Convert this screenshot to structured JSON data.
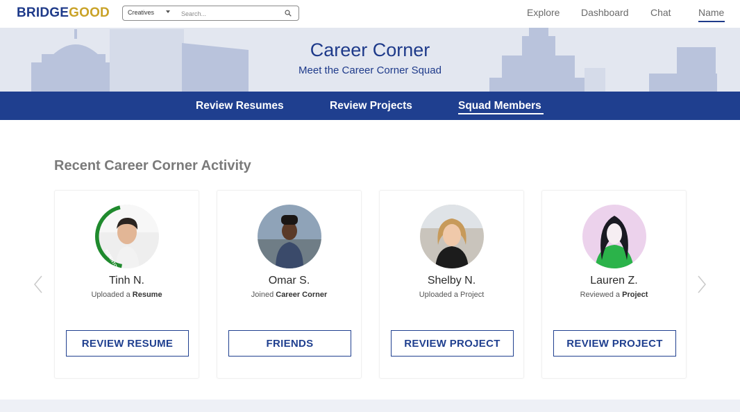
{
  "brand": {
    "part1": "BRIDGE",
    "part2": "GOOD",
    "color_primary": "#1e3a8a",
    "color_accent": "#c9a227"
  },
  "search": {
    "category": "Creatives",
    "placeholder": "Search...",
    "icon": "search-icon"
  },
  "nav": {
    "explore": "Explore",
    "dashboard": "Dashboard",
    "chat": "Chat",
    "name": "Name"
  },
  "hero": {
    "title": "Career Corner",
    "subtitle": "Meet the Career Corner Squad"
  },
  "tabs": {
    "review_resumes": "Review Resumes",
    "review_projects": "Review Projects",
    "squad_members": "Squad Members",
    "active": "Squad Members"
  },
  "section": {
    "title": "Recent Career Corner Activity"
  },
  "cards": [
    {
      "name": "Tinh N.",
      "action_prefix": "Uploaded a ",
      "action_target": "Resume",
      "button": "REVIEW RESUME"
    },
    {
      "name": "Omar S.",
      "action_prefix": "Joined ",
      "action_target": "Career Corner",
      "button": "FRIENDS"
    },
    {
      "name": "Shelby N.",
      "action_prefix": "Uploaded a Project",
      "action_target": "",
      "button": "REVIEW PROJECT"
    },
    {
      "name": "Lauren Z.",
      "action_prefix": "Reviewed a ",
      "action_target": "Project",
      "button": "REVIEW PROJECT"
    }
  ],
  "carousel": {
    "prev_icon": "chevron-left-icon",
    "next_icon": "chevron-right-icon"
  }
}
